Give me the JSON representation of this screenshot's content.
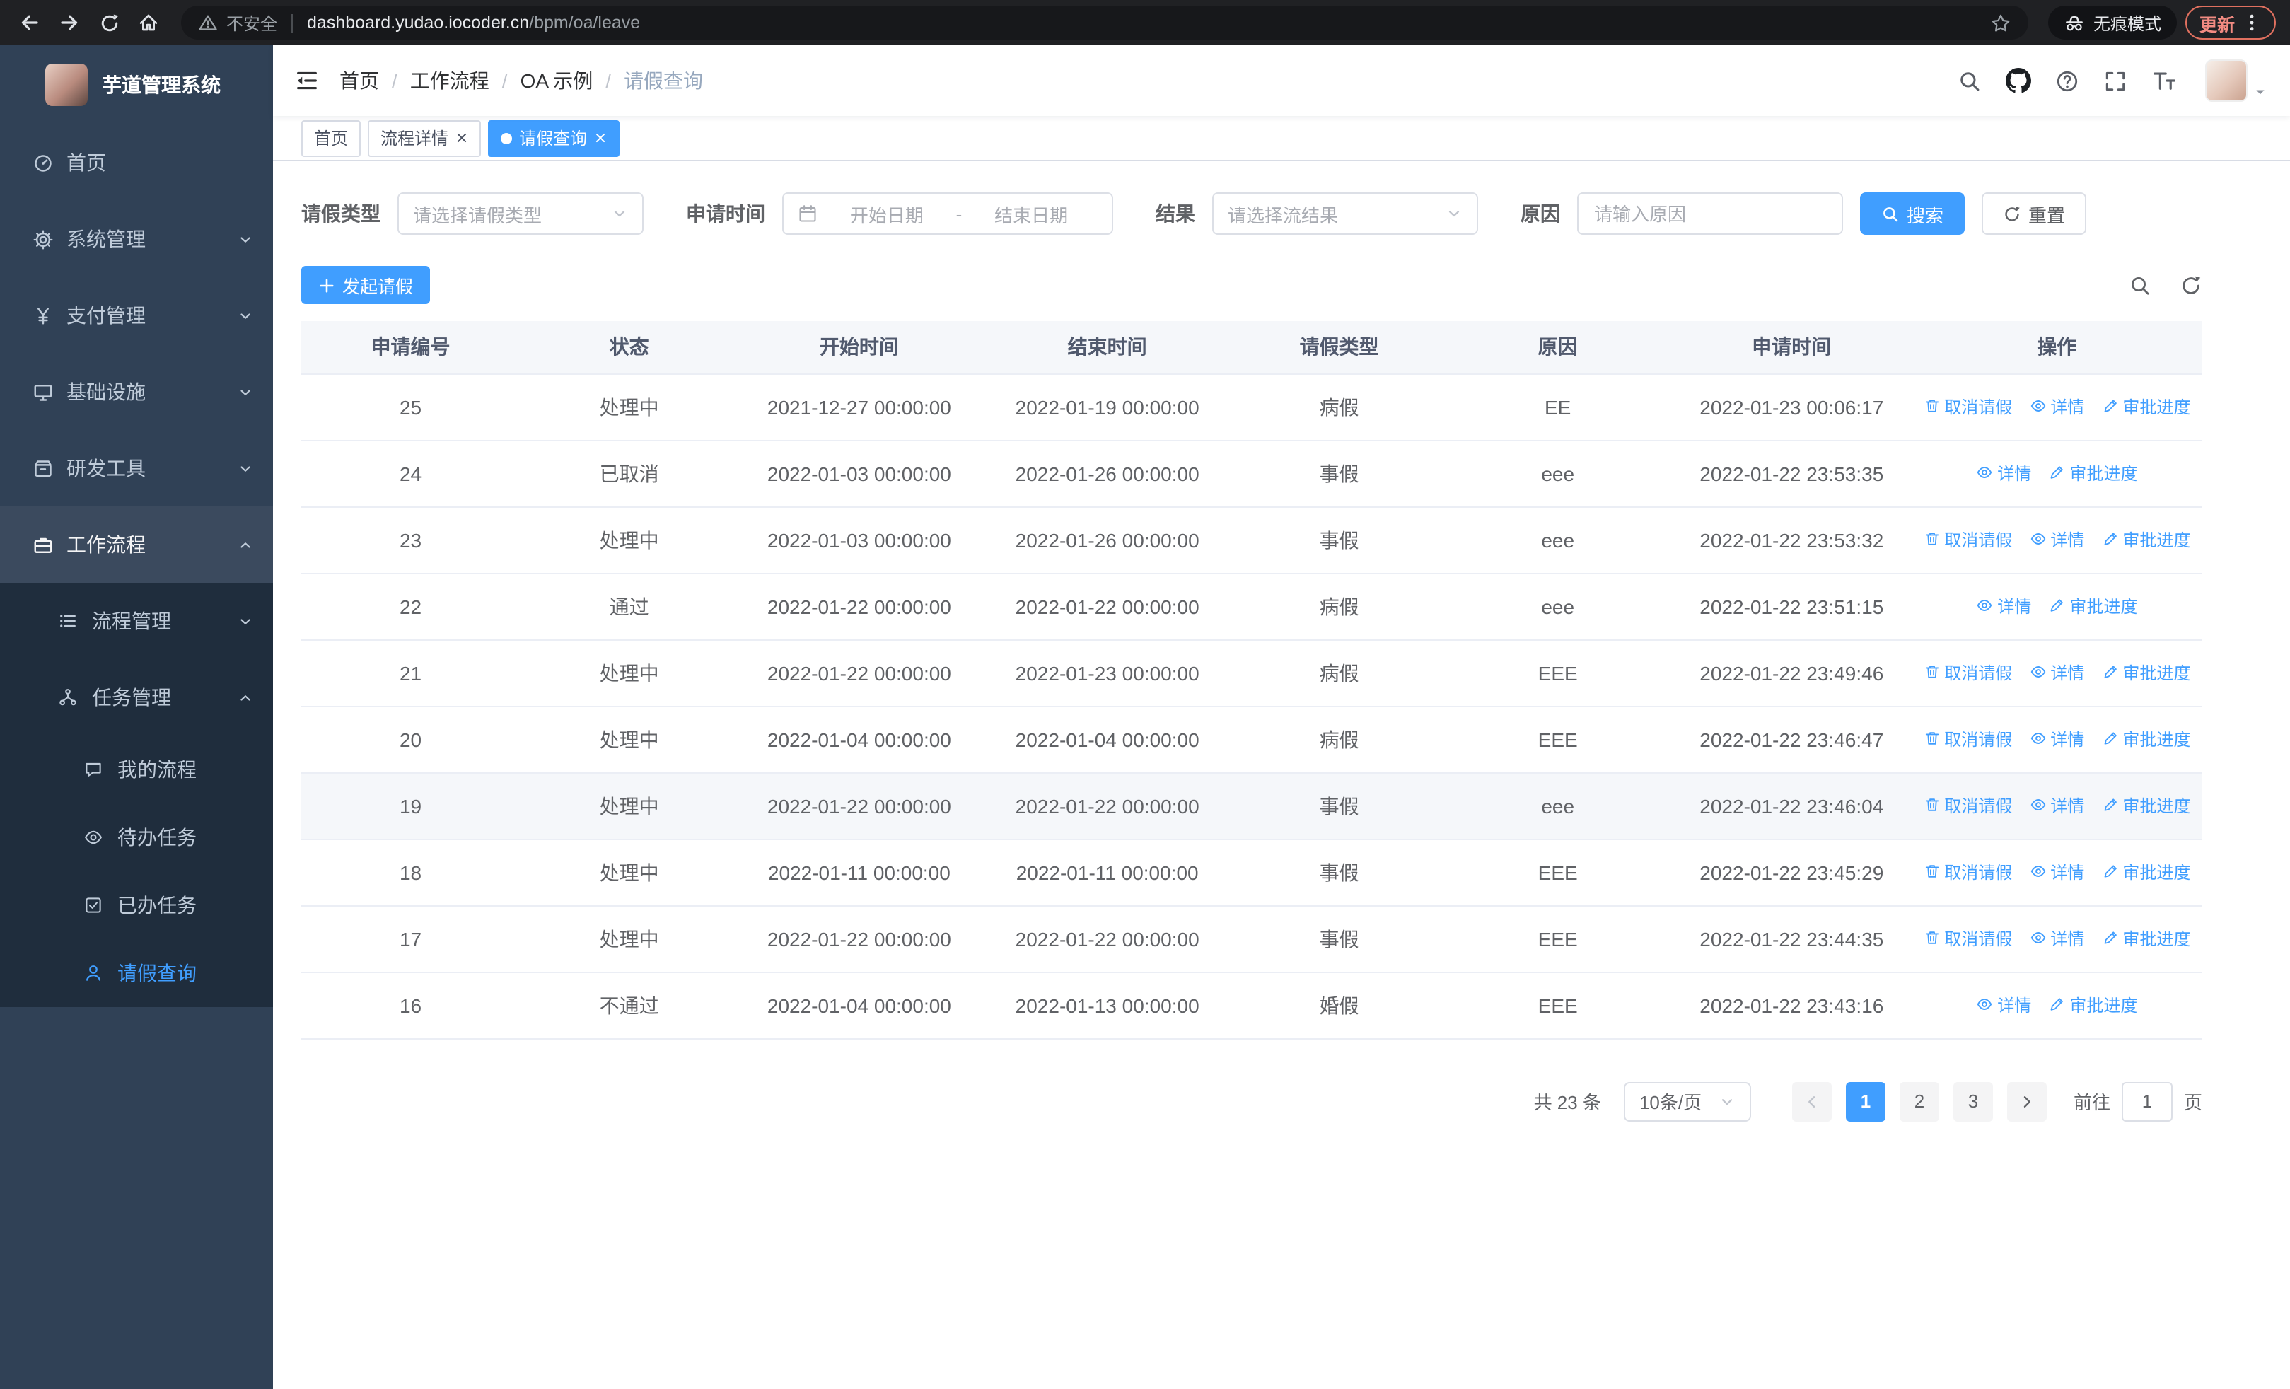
{
  "browser": {
    "security_label": "不安全",
    "url_host": "dashboard.yudao.iocoder.cn",
    "url_path": "/bpm/oa/leave",
    "incognito_label": "无痕模式",
    "update_label": "更新"
  },
  "sidebar": {
    "title": "芋道管理系统",
    "items": [
      {
        "label": "首页"
      },
      {
        "label": "系统管理"
      },
      {
        "label": "支付管理"
      },
      {
        "label": "基础设施"
      },
      {
        "label": "研发工具"
      },
      {
        "label": "工作流程",
        "children": [
          {
            "label": "流程管理"
          },
          {
            "label": "任务管理",
            "children": [
              {
                "label": "我的流程"
              },
              {
                "label": "待办任务"
              },
              {
                "label": "已办任务"
              },
              {
                "label": "请假查询",
                "active": true
              }
            ]
          }
        ]
      }
    ]
  },
  "navbar": {
    "separator": "/",
    "breadcrumb": [
      "首页",
      "工作流程",
      "OA 示例",
      "请假查询"
    ]
  },
  "tabs": [
    {
      "label": "首页",
      "closable": false,
      "active": false
    },
    {
      "label": "流程详情",
      "closable": true,
      "active": false
    },
    {
      "label": "请假查询",
      "closable": true,
      "active": true
    }
  ],
  "filters": {
    "leave_type_label": "请假类型",
    "leave_type_placeholder": "请选择请假类型",
    "apply_time_label": "申请时间",
    "start_date_placeholder": "开始日期",
    "range_separator": "-",
    "end_date_placeholder": "结束日期",
    "result_label": "结果",
    "result_placeholder": "请选择流结果",
    "reason_label": "原因",
    "reason_placeholder": "请输入原因",
    "search_button": "搜索",
    "reset_button": "重置"
  },
  "toolbar": {
    "create_button": "发起请假"
  },
  "table": {
    "columns": [
      "申请编号",
      "状态",
      "开始时间",
      "结束时间",
      "请假类型",
      "原因",
      "申请时间",
      "操作"
    ],
    "op_labels": {
      "cancel": "取消请假",
      "detail": "详情",
      "progress": "审批进度"
    },
    "rows": [
      {
        "id": "25",
        "status": "处理中",
        "start": "2021-12-27 00:00:00",
        "end": "2022-01-19 00:00:00",
        "type": "病假",
        "reason": "EE",
        "applied": "2022-01-23 00:06:17",
        "ops": [
          "cancel",
          "detail",
          "progress"
        ]
      },
      {
        "id": "24",
        "status": "已取消",
        "start": "2022-01-03 00:00:00",
        "end": "2022-01-26 00:00:00",
        "type": "事假",
        "reason": "eee",
        "applied": "2022-01-22 23:53:35",
        "ops": [
          "detail",
          "progress"
        ]
      },
      {
        "id": "23",
        "status": "处理中",
        "start": "2022-01-03 00:00:00",
        "end": "2022-01-26 00:00:00",
        "type": "事假",
        "reason": "eee",
        "applied": "2022-01-22 23:53:32",
        "ops": [
          "cancel",
          "detail",
          "progress"
        ]
      },
      {
        "id": "22",
        "status": "通过",
        "start": "2022-01-22 00:00:00",
        "end": "2022-01-22 00:00:00",
        "type": "病假",
        "reason": "eee",
        "applied": "2022-01-22 23:51:15",
        "ops": [
          "detail",
          "progress"
        ]
      },
      {
        "id": "21",
        "status": "处理中",
        "start": "2022-01-22 00:00:00",
        "end": "2022-01-23 00:00:00",
        "type": "病假",
        "reason": "EEE",
        "applied": "2022-01-22 23:49:46",
        "ops": [
          "cancel",
          "detail",
          "progress"
        ]
      },
      {
        "id": "20",
        "status": "处理中",
        "start": "2022-01-04 00:00:00",
        "end": "2022-01-04 00:00:00",
        "type": "病假",
        "reason": "EEE",
        "applied": "2022-01-22 23:46:47",
        "ops": [
          "cancel",
          "detail",
          "progress"
        ]
      },
      {
        "id": "19",
        "status": "处理中",
        "start": "2022-01-22 00:00:00",
        "end": "2022-01-22 00:00:00",
        "type": "事假",
        "reason": "eee",
        "applied": "2022-01-22 23:46:04",
        "ops": [
          "cancel",
          "detail",
          "progress"
        ],
        "hover": true
      },
      {
        "id": "18",
        "status": "处理中",
        "start": "2022-01-11 00:00:00",
        "end": "2022-01-11 00:00:00",
        "type": "事假",
        "reason": "EEE",
        "applied": "2022-01-22 23:45:29",
        "ops": [
          "cancel",
          "detail",
          "progress"
        ]
      },
      {
        "id": "17",
        "status": "处理中",
        "start": "2022-01-22 00:00:00",
        "end": "2022-01-22 00:00:00",
        "type": "事假",
        "reason": "EEE",
        "applied": "2022-01-22 23:44:35",
        "ops": [
          "cancel",
          "detail",
          "progress"
        ]
      },
      {
        "id": "16",
        "status": "不通过",
        "start": "2022-01-04 00:00:00",
        "end": "2022-01-13 00:00:00",
        "type": "婚假",
        "reason": "EEE",
        "applied": "2022-01-22 23:43:16",
        "ops": [
          "detail",
          "progress"
        ]
      }
    ]
  },
  "pagination": {
    "total": "共 23 条",
    "page_size": "10条/页",
    "pages": [
      "1",
      "2",
      "3"
    ],
    "active_page": "1",
    "goto_label": "前往",
    "goto_value": "1",
    "goto_suffix": "页"
  },
  "colors": {
    "primary": "#409EFF",
    "sidebar_bg": "#304156",
    "submenu_bg": "#1f2d3d"
  }
}
